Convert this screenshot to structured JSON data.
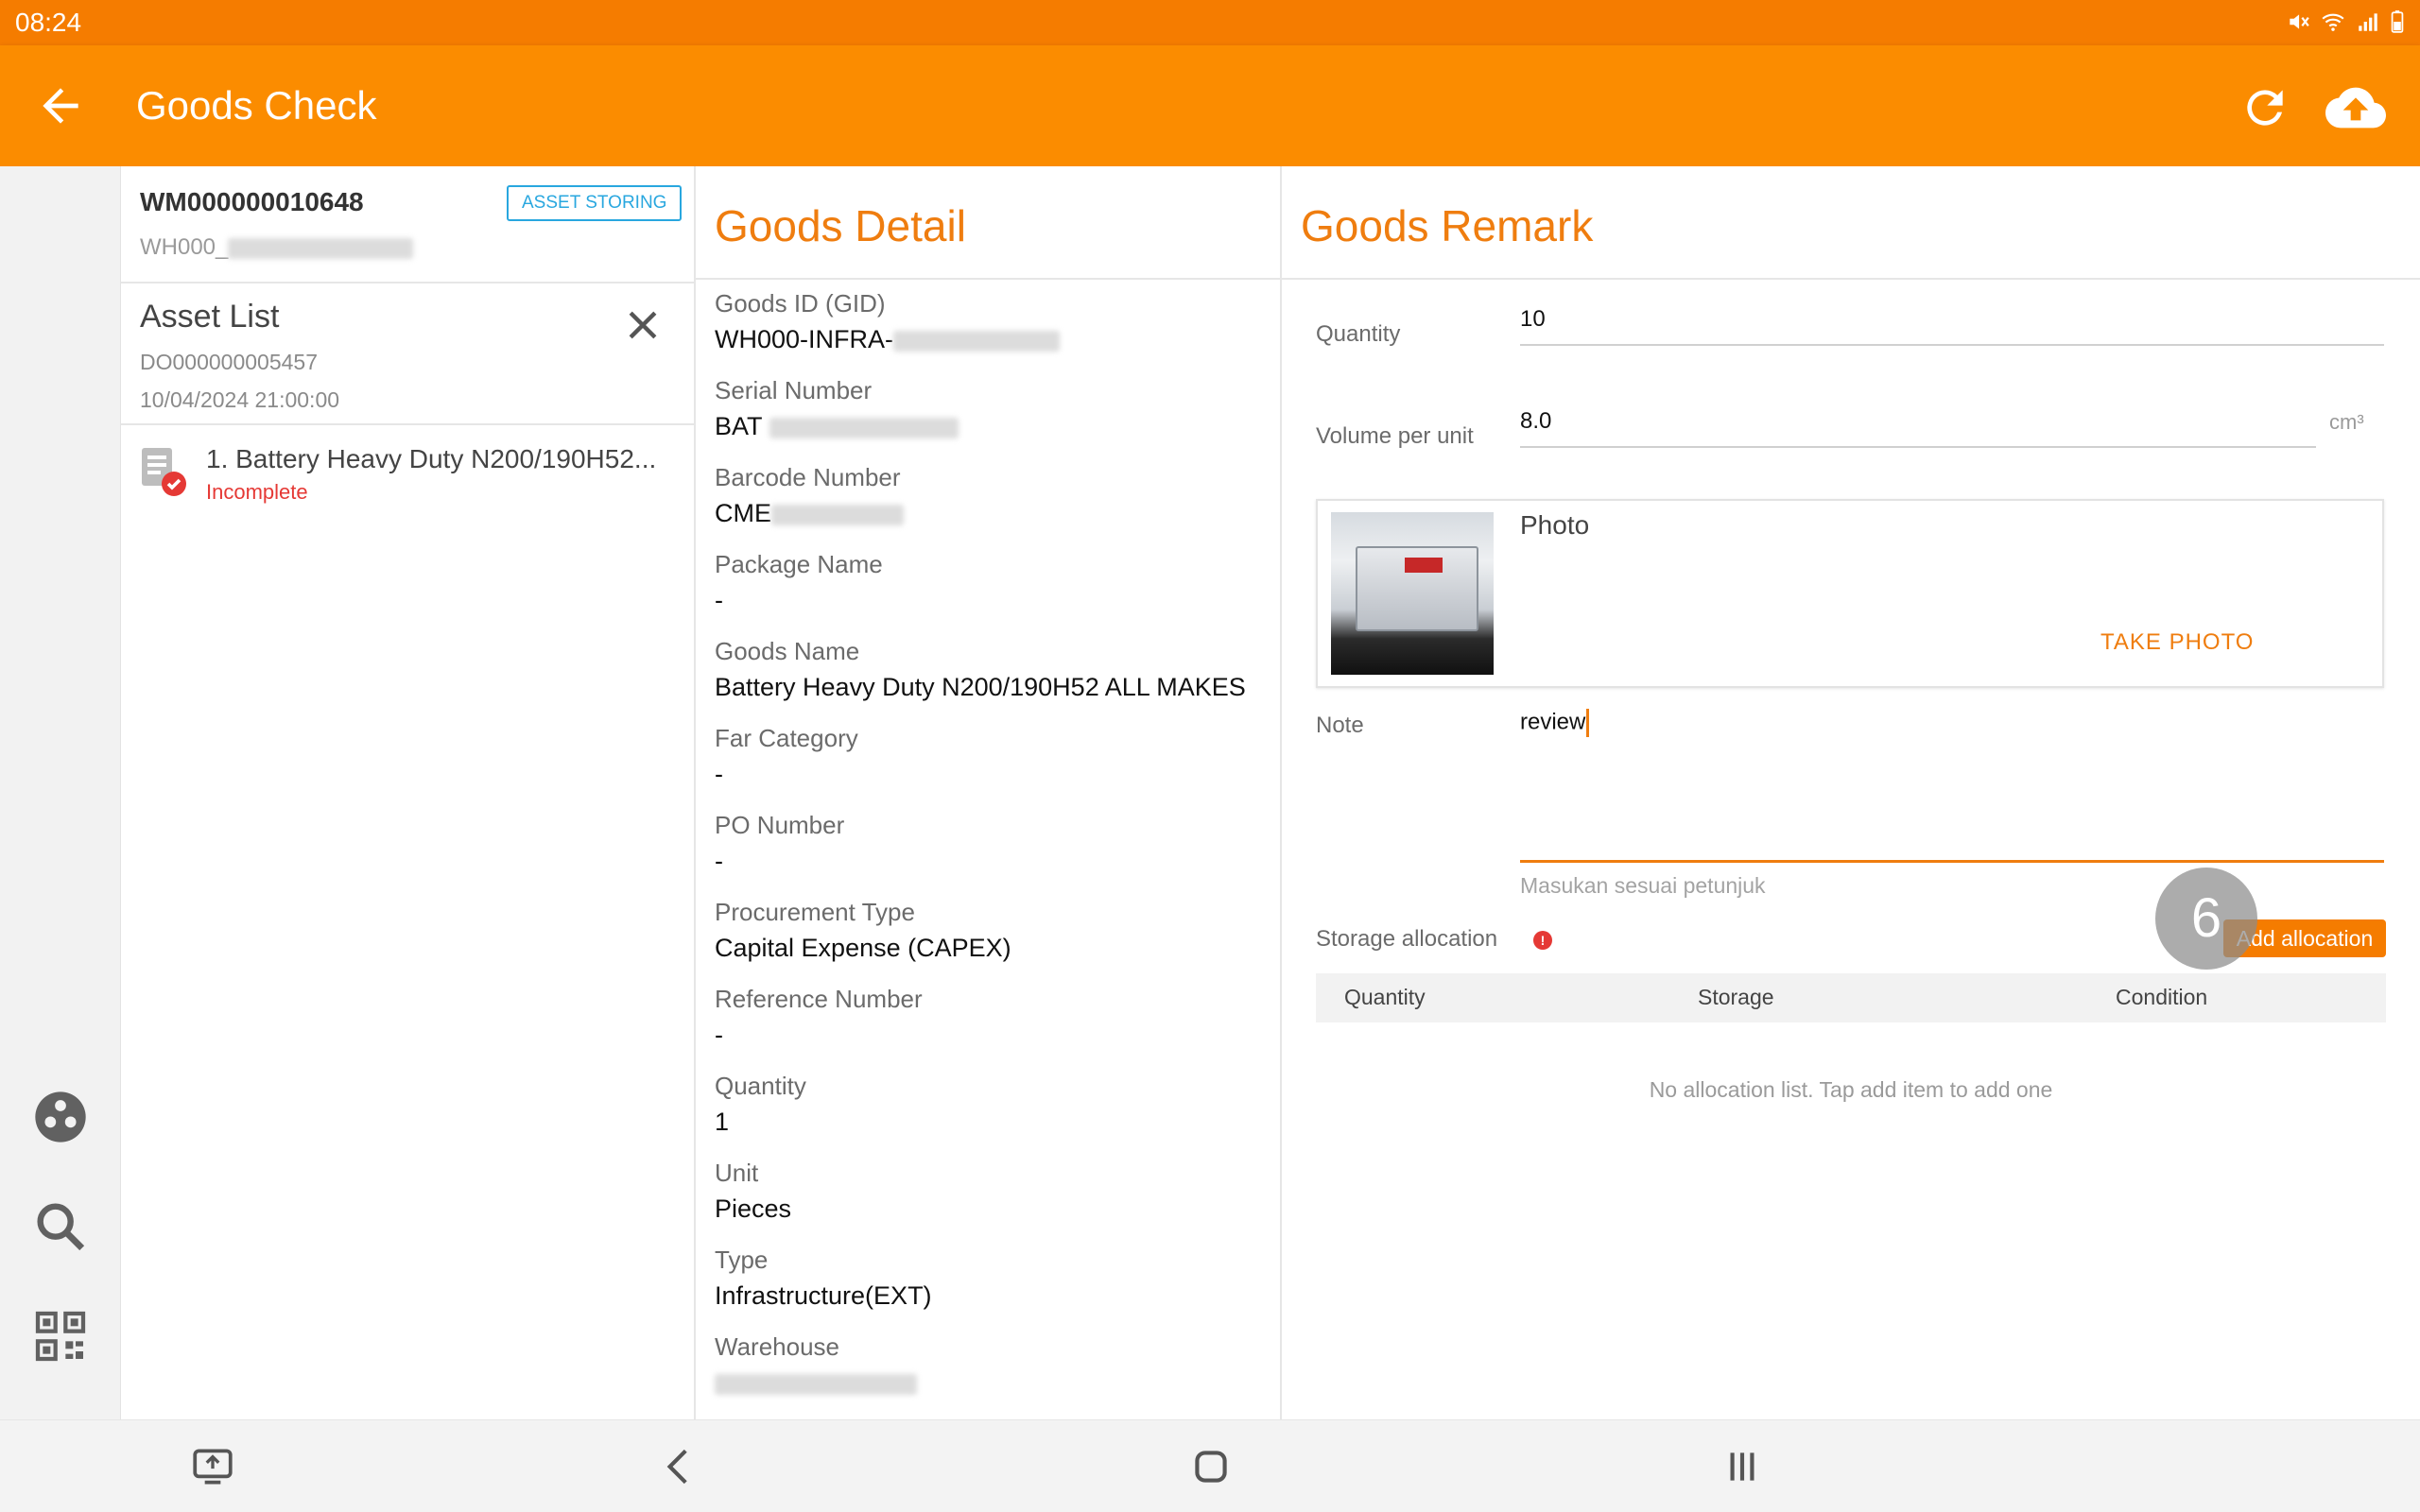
{
  "status_bar": {
    "time": "08:24"
  },
  "app_bar": {
    "title": "Goods Check"
  },
  "warehouse_movement": {
    "id": "WM000000010648",
    "wh_prefix": "WH000_",
    "badge": "ASSET STORING"
  },
  "asset_list": {
    "title": "Asset List",
    "do_number": "DO000000005457",
    "date": "10/04/2024 21:00:00",
    "items": [
      {
        "name": "1. Battery Heavy Duty N200/190H52...",
        "status": "Incomplete"
      }
    ]
  },
  "goods_detail": {
    "title": "Goods Detail",
    "fields": [
      {
        "label": "Goods ID (GID)",
        "value": "WH000-INFRA-"
      },
      {
        "label": "Serial Number",
        "value": "BAT"
      },
      {
        "label": "Barcode Number",
        "value": "CME"
      },
      {
        "label": "Package Name",
        "value": "-"
      },
      {
        "label": "Goods Name",
        "value": "Battery Heavy Duty N200/190H52 ALL MAKES"
      },
      {
        "label": "Far Category",
        "value": "-"
      },
      {
        "label": "PO Number",
        "value": "-"
      },
      {
        "label": "Procurement Type",
        "value": "Capital Expense (CAPEX)"
      },
      {
        "label": "Reference Number",
        "value": "-"
      },
      {
        "label": "Quantity",
        "value": "1"
      },
      {
        "label": "Unit",
        "value": "Pieces"
      },
      {
        "label": "Type",
        "value": "Infrastructure(EXT)"
      },
      {
        "label": "Warehouse",
        "value": ""
      }
    ]
  },
  "goods_remark": {
    "title": "Goods Remark",
    "quantity_label": "Quantity",
    "quantity_value": "10",
    "volume_label": "Volume per unit",
    "volume_value": "8.0",
    "volume_unit": "cm³",
    "photo_label": "Photo",
    "take_photo": "TAKE PHOTO",
    "note_label": "Note",
    "note_value": "review",
    "note_hint": "Masukan sesuai petunjuk",
    "storage_label": "Storage allocation",
    "add_allocation": "Add allocation",
    "touch_indicator": "6",
    "table_headers": [
      "Quantity",
      "Storage",
      "Condition"
    ],
    "empty_text": "No allocation list. Tap add item to add one"
  },
  "colors": {
    "primary": "#fb8c00",
    "accent": "#ef7d0f",
    "error": "#e53935",
    "badge": "#29a7df"
  }
}
